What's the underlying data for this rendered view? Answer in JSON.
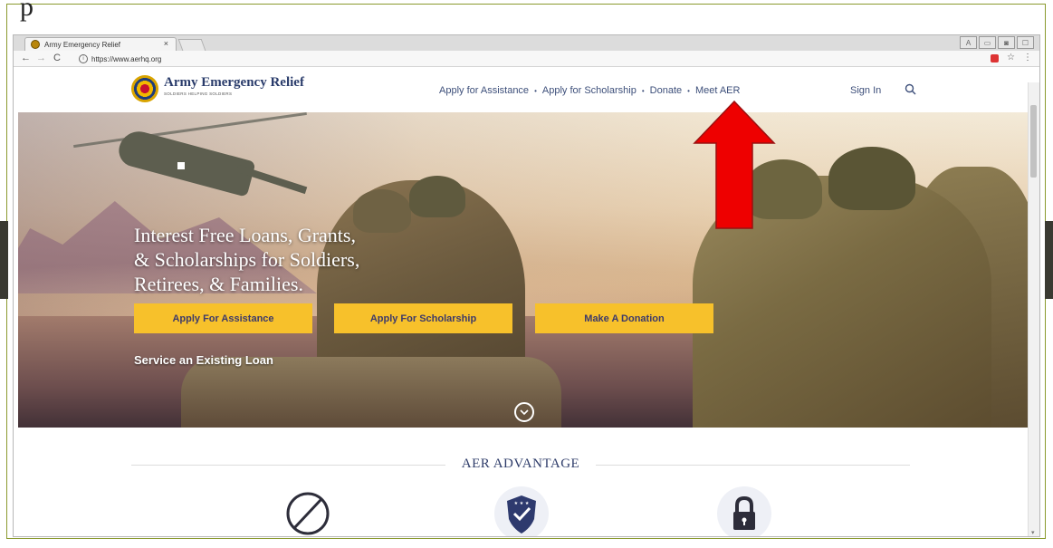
{
  "slide": {
    "top_mark": "p"
  },
  "browser": {
    "tab_title": "Army Emergency Relief",
    "tab_close": "×",
    "url": "https://www.aerhq.org",
    "window_controls": [
      "A",
      "▭",
      "◙",
      "☐"
    ]
  },
  "site": {
    "logo_name": "Army Emergency Relief",
    "logo_tagline": "SOLDIERS HELPING SOLDIERS",
    "nav": [
      "Apply for Assistance",
      "Apply for Scholarship",
      "Donate",
      "Meet AER"
    ],
    "nav_separator": "•",
    "sign_in": "Sign In"
  },
  "hero": {
    "headline_lines": [
      "Interest Free Loans, Grants,",
      "& Scholarships for Soldiers,",
      "Retirees, & Families."
    ],
    "buttons": [
      "Apply For Assistance",
      "Apply For Scholarship",
      "Make A Donation"
    ],
    "service_link": "Service an Existing Loan"
  },
  "advantage": {
    "title": "AER ADVANTAGE",
    "icons": [
      "no-entry-icon",
      "shield-check-icon",
      "lock-icon"
    ]
  },
  "colors": {
    "accent_button": "#f7c12b",
    "nav_text": "#3d4f7a",
    "annotation_arrow": "#ee0000",
    "frame": "#8a9a2e"
  }
}
